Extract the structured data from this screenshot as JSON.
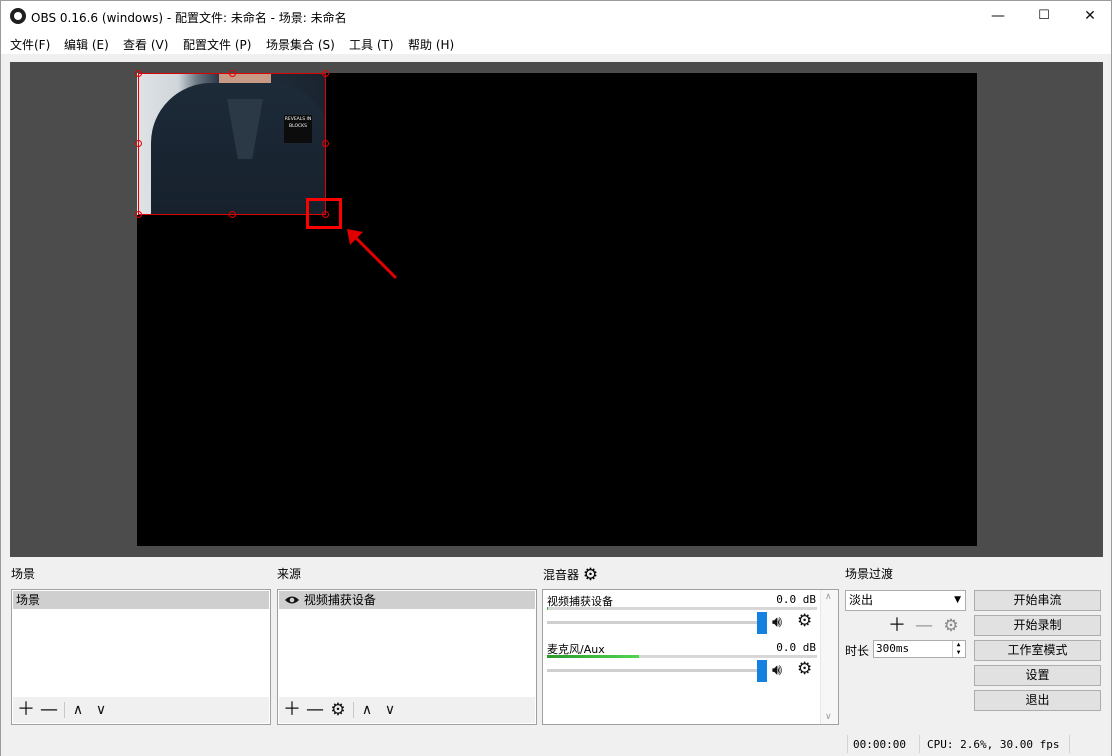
{
  "window": {
    "title": "OBS 0.16.6 (windows) - 配置文件: 未命名 - 场景: 未命名",
    "minimize": "—",
    "maximize": "☐",
    "close": "✕"
  },
  "menu": [
    "文件(F)",
    "编辑 (E)",
    "查看 (V)",
    "配置文件 (P)",
    "场景集合 (S)",
    "工具 (T)",
    "帮助 (H)"
  ],
  "preview": {
    "webcam_shirt_text": "REVEALS IN BLOCKS",
    "selection_color": "#e00000",
    "highlight_color": "#ff0000"
  },
  "scenes": {
    "title": "场景",
    "items": [
      "场景"
    ],
    "selected": "场景"
  },
  "sources": {
    "title": "来源",
    "items": [
      "视频捕获设备"
    ],
    "visible_icon": "eye-icon"
  },
  "mixer": {
    "title": "混音器",
    "channels": [
      {
        "name": "视频捕获设备",
        "db": "0.0 dB",
        "level": 0.0,
        "volume": 1.0
      },
      {
        "name": "麦克风/Aux",
        "db": "0.0 dB",
        "level": 0.34,
        "volume": 1.0
      }
    ]
  },
  "transitions": {
    "title": "场景过渡",
    "selected": "淡出",
    "duration_label": "时长",
    "duration_value": "300ms"
  },
  "controls": {
    "start_stream": "开始串流",
    "start_record": "开始录制",
    "studio_mode": "工作室模式",
    "settings": "设置",
    "exit": "退出"
  },
  "status": {
    "time": "00:00:00",
    "perf": "CPU: 2.6%, 30.00 fps"
  }
}
